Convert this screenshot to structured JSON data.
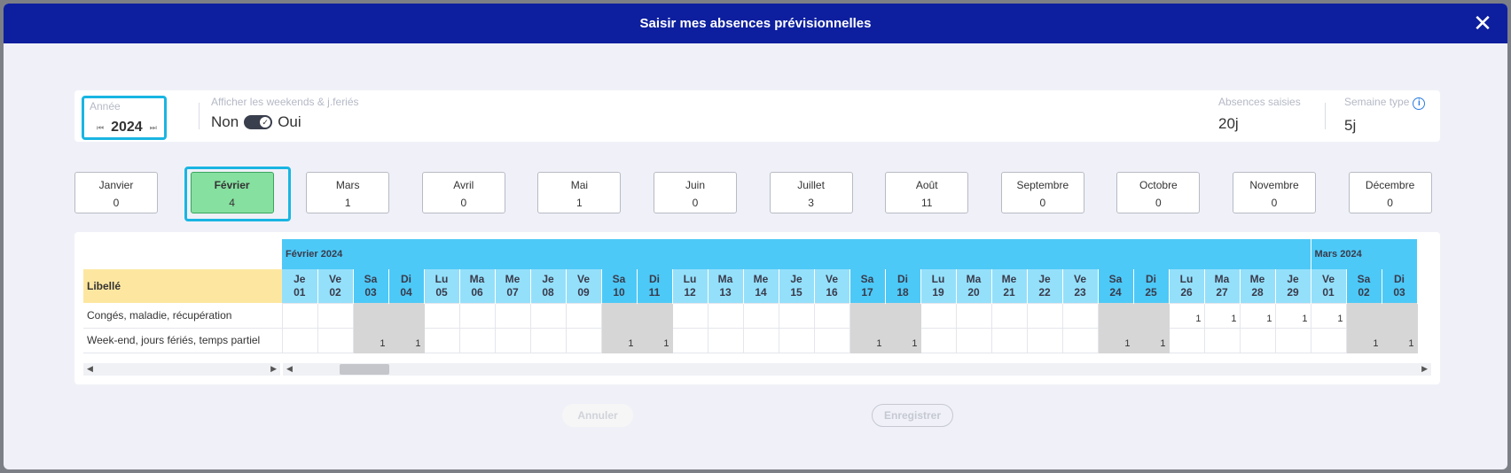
{
  "modal": {
    "title": "Saisir mes absences prévisionnelles"
  },
  "toolbar": {
    "year_label": "Année",
    "year_value": "2024",
    "weekend_label": "Afficher les weekends & j.feriés",
    "toggle_off": "Non",
    "toggle_on": "Oui",
    "toggle_state": "on",
    "absences_label": "Absences saisies",
    "absences_value": "20j",
    "semaine_label": "Semaine type",
    "semaine_value": "5j"
  },
  "months": [
    {
      "name": "Janvier",
      "count": "0"
    },
    {
      "name": "Février",
      "count": "4",
      "active": true
    },
    {
      "name": "Mars",
      "count": "1"
    },
    {
      "name": "Avril",
      "count": "0"
    },
    {
      "name": "Mai",
      "count": "1"
    },
    {
      "name": "Juin",
      "count": "0"
    },
    {
      "name": "Juillet",
      "count": "3"
    },
    {
      "name": "Août",
      "count": "11"
    },
    {
      "name": "Septembre",
      "count": "0"
    },
    {
      "name": "Octobre",
      "count": "0"
    },
    {
      "name": "Novembre",
      "count": "0"
    },
    {
      "name": "Décembre",
      "count": "0"
    }
  ],
  "grid": {
    "libelle_header": "Libellé",
    "month_headers": [
      "Février 2024",
      "Mars 2024"
    ],
    "days": [
      {
        "d": "Je",
        "n": "01"
      },
      {
        "d": "Ve",
        "n": "02"
      },
      {
        "d": "Sa",
        "n": "03",
        "we": true
      },
      {
        "d": "Di",
        "n": "04",
        "we": true
      },
      {
        "d": "Lu",
        "n": "05"
      },
      {
        "d": "Ma",
        "n": "06"
      },
      {
        "d": "Me",
        "n": "07"
      },
      {
        "d": "Je",
        "n": "08"
      },
      {
        "d": "Ve",
        "n": "09"
      },
      {
        "d": "Sa",
        "n": "10",
        "we": true
      },
      {
        "d": "Di",
        "n": "11",
        "we": true
      },
      {
        "d": "Lu",
        "n": "12"
      },
      {
        "d": "Ma",
        "n": "13"
      },
      {
        "d": "Me",
        "n": "14"
      },
      {
        "d": "Je",
        "n": "15"
      },
      {
        "d": "Ve",
        "n": "16"
      },
      {
        "d": "Sa",
        "n": "17",
        "we": true
      },
      {
        "d": "Di",
        "n": "18",
        "we": true
      },
      {
        "d": "Lu",
        "n": "19"
      },
      {
        "d": "Ma",
        "n": "20"
      },
      {
        "d": "Me",
        "n": "21"
      },
      {
        "d": "Je",
        "n": "22"
      },
      {
        "d": "Ve",
        "n": "23"
      },
      {
        "d": "Sa",
        "n": "24",
        "we": true
      },
      {
        "d": "Di",
        "n": "25",
        "we": true
      },
      {
        "d": "Lu",
        "n": "26"
      },
      {
        "d": "Ma",
        "n": "27"
      },
      {
        "d": "Me",
        "n": "28"
      },
      {
        "d": "Je",
        "n": "29"
      },
      {
        "d": "Ve",
        "n": "01"
      },
      {
        "d": "Sa",
        "n": "02",
        "we": true
      },
      {
        "d": "Di",
        "n": "03",
        "we": true
      }
    ],
    "rows": [
      {
        "label": "Congés, maladie, récupération",
        "values": [
          "",
          "",
          "",
          "",
          "",
          "",
          "",
          "",
          "",
          "",
          "",
          "",
          "",
          "",
          "",
          "",
          "",
          "",
          "",
          "",
          "",
          "",
          "",
          "",
          "",
          "1",
          "1",
          "1",
          "1",
          "1",
          "",
          ""
        ]
      },
      {
        "label": "Week-end, jours fériés, temps partiel",
        "values": [
          "",
          "",
          "1",
          "1",
          "",
          "",
          "",
          "",
          "",
          "1",
          "1",
          "",
          "",
          "",
          "",
          "",
          "1",
          "1",
          "",
          "",
          "",
          "",
          "",
          "1",
          "1",
          "",
          "",
          "",
          "",
          "",
          "1",
          "1"
        ]
      }
    ]
  },
  "footer": {
    "cancel_label": "Annuler",
    "save_label": "Enregistrer"
  }
}
